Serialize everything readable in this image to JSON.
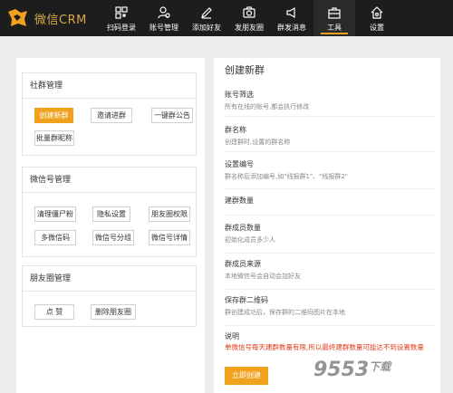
{
  "app": {
    "brand_name": "微信CRM",
    "brand_color": "#f0a11e"
  },
  "nav": {
    "items": [
      {
        "label": "扫码登录",
        "icon": "qr-code-icon"
      },
      {
        "label": "账号管理",
        "icon": "user-icon"
      },
      {
        "label": "添加好友",
        "icon": "edit-icon"
      },
      {
        "label": "发朋友圈",
        "icon": "camera-icon"
      },
      {
        "label": "群发消息",
        "icon": "broadcast-icon"
      },
      {
        "label": "工具",
        "icon": "toolbox-icon",
        "active": true
      },
      {
        "label": "设置",
        "icon": "home-settings-icon"
      }
    ]
  },
  "left": {
    "groups": [
      {
        "title": "社群管理",
        "buttons": [
          "创建新群",
          "邀请进群",
          "一键群公告",
          "批量群昵称"
        ]
      },
      {
        "title": "微信号管理",
        "buttons": [
          "清理僵尸粉",
          "隐私设置",
          "朋友圈权限",
          "多微信码",
          "微信号分组",
          "微信号详情"
        ]
      },
      {
        "title": "朋友圈管理",
        "buttons": [
          "点 赞",
          "删除朋友圈"
        ]
      }
    ]
  },
  "right": {
    "title": "创建新群",
    "fields": [
      {
        "label": "账号筛选",
        "desc": "所有在线的账号,都会执行修改"
      },
      {
        "label": "群名称",
        "desc": "创建群时,设置的群名称"
      },
      {
        "label": "设置编号",
        "desc": "群名称后添加编号,如\"线报群1\"、\"线报群2\""
      },
      {
        "label": "建群数量",
        "desc": ""
      },
      {
        "label": "群成员数量",
        "desc": "初始化成员多少人"
      },
      {
        "label": "群成员来源",
        "desc": "本地微信号会自动会加好友"
      },
      {
        "label": "保存群二维码",
        "desc": "群创建成功后，保存群的二维码图片在本地"
      }
    ],
    "note_label": "说明",
    "warning": "单微信号每天建群数量有限,所以最终建群数量可能达不到设置数量",
    "create_button": "立即创建"
  },
  "watermark": {
    "text": "9553",
    "sub": "下载"
  }
}
